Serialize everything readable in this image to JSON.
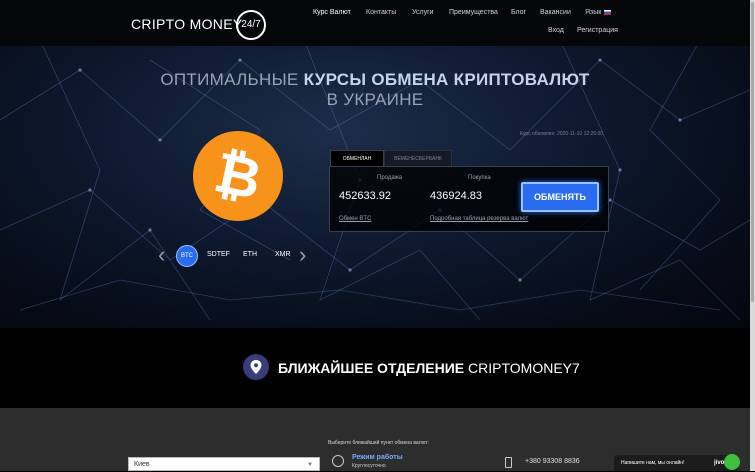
{
  "header": {
    "logo_text": "CRIPTO MONEY",
    "logo_badge": "24/7",
    "nav": [
      {
        "label": "Курс Валют"
      },
      {
        "label": "Контакты"
      },
      {
        "label": "Услуги"
      },
      {
        "label": "Преимущества"
      },
      {
        "label": "Блог"
      },
      {
        "label": "Вакансии"
      },
      {
        "label": "Язык"
      }
    ],
    "login": "Вход",
    "register": "Регистрация"
  },
  "hero": {
    "headline_pre": "ОПТИМАЛЬНЫЕ ",
    "headline_bold": "КУРСЫ ОБМЕНА КРИПТОВАЛЮТ",
    "headline_post": " В УКРАИНЕ",
    "rate_date": "Курс обновлен: 2020-11-10 12:26:00",
    "coin_symbol": "₿"
  },
  "exchange": {
    "tab_active": "ОБМЕНЛАН",
    "tab_inactive": "ВЕМЕНЕСБЕРБАНК",
    "sell_label": "Продажа",
    "buy_label": "Покупка",
    "sell_value": "452633.92",
    "buy_value": "436924.83",
    "button": "ОБМЕНЯТЬ",
    "link_exchange": "Обмен BTC",
    "link_table": "Подробная таблица резерва валют"
  },
  "coins": [
    "BTC",
    "SDTEF",
    "ETH",
    "XMR"
  ],
  "nearest": {
    "title_bold": "БЛИЖАЙШЕЕ ОТДЕЛЕНИЕ ",
    "title_light": "CRIPTOMONEY7"
  },
  "office": {
    "choose_label": "Выберите ближайший пункт обмена валют:",
    "city": "Киев",
    "mode_title": "Режим работы",
    "mode_sub": "Круглосуточно",
    "phone": "+380 93308 8836"
  },
  "chat": {
    "text": "Напишите нам, мы онлайн!",
    "brand": "jivo"
  },
  "colors": {
    "accent": "#2a6cf0",
    "coin": "#f7931a",
    "pin": "#3a3d7a"
  }
}
